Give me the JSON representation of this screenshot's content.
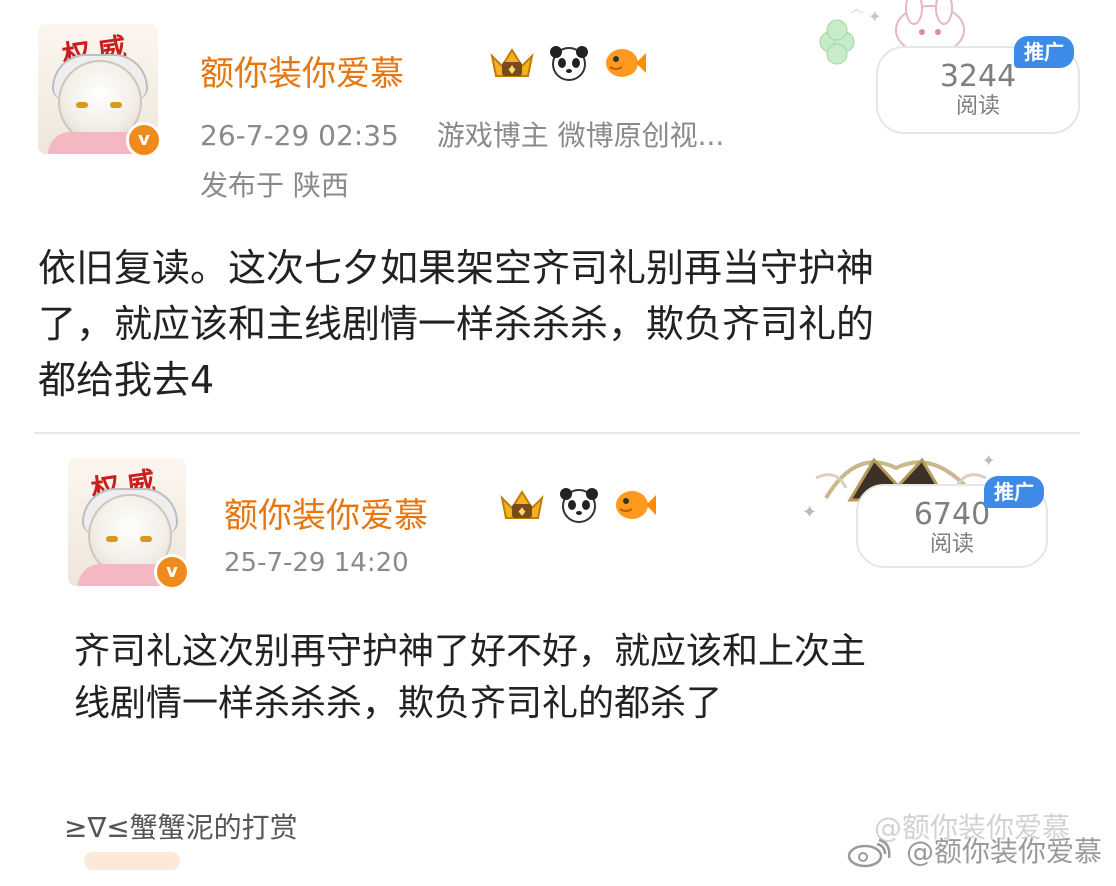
{
  "main_post": {
    "username": "额你装你爱慕",
    "avatar_text": "权威",
    "verified_mark": "v",
    "timestamp": "26-7-29 02:35",
    "category": "游戏博主 微博原创视...",
    "location": "发布于 陕西",
    "reads": "3244",
    "reads_label": "阅读",
    "promo_tag": "推广",
    "text_line1": "依旧复读。这次七夕如果架空齐司礼别再当守护神",
    "text_line2": "了，就应该和主线剧情一样杀杀杀，欺负齐司礼的",
    "text_line3": "都给我去4"
  },
  "repost": {
    "username": "额你装你爱慕",
    "avatar_text": "权威",
    "verified_mark": "v",
    "timestamp": "25-7-29 14:20",
    "reads": "6740",
    "reads_label": "阅读",
    "promo_tag": "推广",
    "text_line1": "齐司礼这次别再守护神了好不好，就应该和上次主",
    "text_line2": "线剧情一样杀杀杀，欺负齐司礼的都杀了"
  },
  "reward": {
    "text": "≥∇≤蟹蟹泥的打赏"
  },
  "watermark": {
    "text": "@额你装你爱慕",
    "ghost_text": "@额你装你爱慕"
  },
  "colors": {
    "username": "#e8760f",
    "meta": "#8a8a8a",
    "promo": "#3d8be6",
    "verified": "#f08a1c",
    "body_text": "#222222"
  },
  "icons": [
    "crown-badge-icon",
    "panda-icon",
    "pufferfish-icon",
    "weibo-logo-icon"
  ]
}
